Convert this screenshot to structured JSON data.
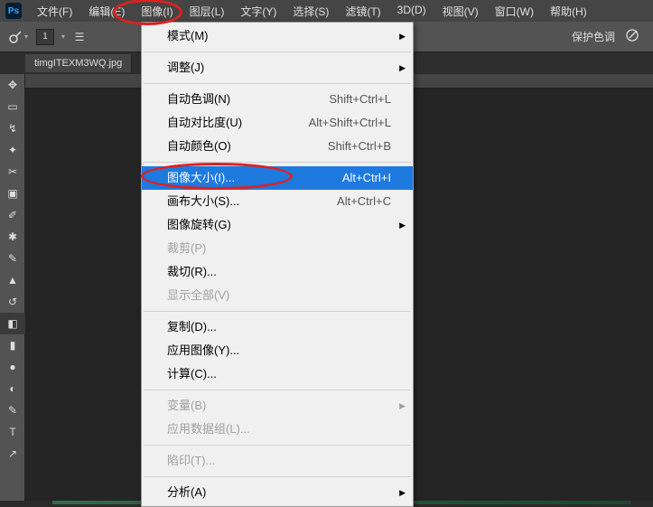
{
  "menubar": {
    "items": [
      {
        "label": "文件(F)"
      },
      {
        "label": "编辑(E)"
      },
      {
        "label": "图像(I)"
      },
      {
        "label": "图层(L)"
      },
      {
        "label": "文字(Y)"
      },
      {
        "label": "选择(S)"
      },
      {
        "label": "滤镜(T)"
      },
      {
        "label": "3D(D)"
      },
      {
        "label": "视图(V)"
      },
      {
        "label": "窗口(W)"
      },
      {
        "label": "帮助(H)"
      }
    ]
  },
  "optionsbar": {
    "num": "1",
    "preserve_tone": "保护色调"
  },
  "tab": {
    "filename": "timgITEXM3WQ.jpg"
  },
  "dropdown": {
    "items": [
      {
        "label": "模式(M)",
        "sub": true
      },
      {
        "sep": true
      },
      {
        "label": "调整(J)",
        "sub": true
      },
      {
        "sep": true
      },
      {
        "label": "自动色调(N)",
        "short": "Shift+Ctrl+L"
      },
      {
        "label": "自动对比度(U)",
        "short": "Alt+Shift+Ctrl+L"
      },
      {
        "label": "自动颜色(O)",
        "short": "Shift+Ctrl+B"
      },
      {
        "sep": true
      },
      {
        "label": "图像大小(I)...",
        "short": "Alt+Ctrl+I",
        "highlight": true
      },
      {
        "label": "画布大小(S)...",
        "short": "Alt+Ctrl+C"
      },
      {
        "label": "图像旋转(G)",
        "sub": true
      },
      {
        "label": "裁剪(P)",
        "disabled": true
      },
      {
        "label": "裁切(R)..."
      },
      {
        "label": "显示全部(V)",
        "disabled": true
      },
      {
        "sep": true
      },
      {
        "label": "复制(D)..."
      },
      {
        "label": "应用图像(Y)..."
      },
      {
        "label": "计算(C)..."
      },
      {
        "sep": true
      },
      {
        "label": "变量(B)",
        "sub": true,
        "disabled": true
      },
      {
        "label": "应用数据组(L)...",
        "disabled": true
      },
      {
        "sep": true
      },
      {
        "label": "陷印(T)...",
        "disabled": true
      },
      {
        "sep": true
      },
      {
        "label": "分析(A)",
        "sub": true
      }
    ]
  },
  "tools": [
    {
      "name": "move-tool",
      "glyph": "✥"
    },
    {
      "name": "marquee-tool",
      "glyph": "▭"
    },
    {
      "name": "lasso-tool",
      "glyph": "↯"
    },
    {
      "name": "wand-tool",
      "glyph": "✦"
    },
    {
      "name": "crop-tool",
      "glyph": "✂"
    },
    {
      "name": "frame-tool",
      "glyph": "▣"
    },
    {
      "name": "eyedropper-tool",
      "glyph": "✐"
    },
    {
      "name": "heal-tool",
      "glyph": "✱"
    },
    {
      "name": "brush-tool",
      "glyph": "✎"
    },
    {
      "name": "stamp-tool",
      "glyph": "▲"
    },
    {
      "name": "history-brush",
      "glyph": "↺"
    },
    {
      "name": "eraser-tool",
      "glyph": "◧"
    },
    {
      "name": "gradient-tool",
      "glyph": "▮"
    },
    {
      "name": "blur-tool",
      "glyph": "●"
    },
    {
      "name": "dodge-tool",
      "glyph": "◐"
    },
    {
      "name": "pen-tool",
      "glyph": "✎"
    },
    {
      "name": "type-tool",
      "glyph": "T"
    },
    {
      "name": "path-tool",
      "glyph": "↗"
    }
  ]
}
